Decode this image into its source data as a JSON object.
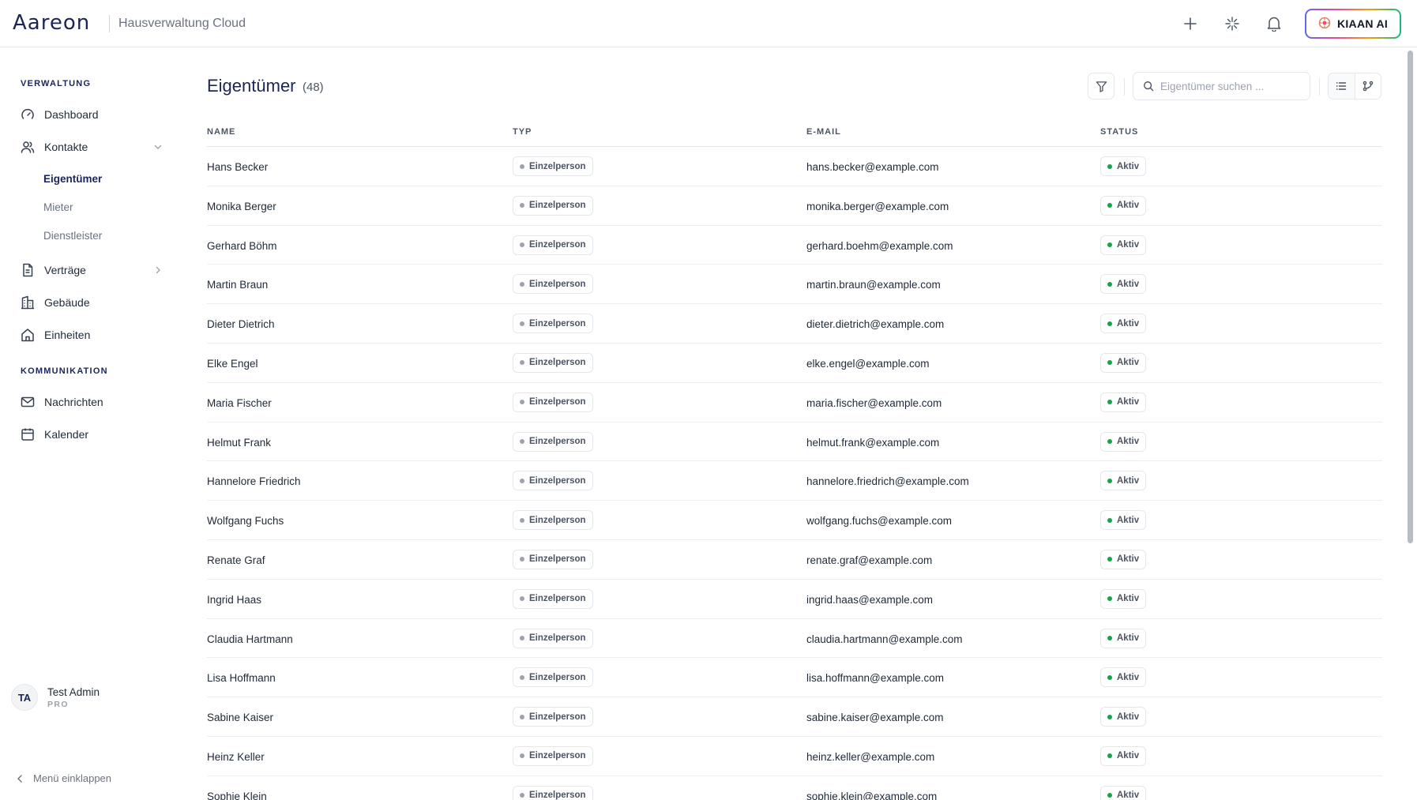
{
  "header": {
    "logo": "Aareon",
    "app_name": "Hausverwaltung Cloud",
    "icons": [
      "plus-icon",
      "sparkle-icon",
      "bell-icon"
    ],
    "ai_button": "KIAAN AI"
  },
  "sidebar": {
    "sections": [
      {
        "title": "VERWALTUNG"
      },
      {
        "title": "KOMMUNIKATION"
      }
    ],
    "items": [
      {
        "label": "Dashboard",
        "icon": "gauge-icon"
      },
      {
        "label": "Kontakte",
        "icon": "users-icon"
      },
      {
        "label": "Verträge",
        "icon": "document-icon"
      },
      {
        "label": "Gebäude",
        "icon": "building-icon"
      },
      {
        "label": "Einheiten",
        "icon": "home-icon"
      },
      {
        "label": "Nachrichten",
        "icon": "mail-icon"
      },
      {
        "label": "Kalender",
        "icon": "calendar-icon"
      }
    ],
    "sub_items": [
      {
        "label": "Eigentümer",
        "active": true
      },
      {
        "label": "Mieter",
        "active": false
      },
      {
        "label": "Dienstleister",
        "active": false
      }
    ],
    "user": {
      "initials": "TA",
      "name": "Test Admin",
      "role": "PRO"
    },
    "collapse_label": "Menü einklappen"
  },
  "main": {
    "title": "Eigentümer",
    "count": "(48)",
    "search_placeholder": "Eigentümer suchen ...",
    "columns": [
      "NAME",
      "TYP",
      "E-MAIL",
      "STATUS"
    ],
    "colors": {
      "status_dot": "#16a34a",
      "type_dot": "#9ca3af",
      "accent": "#1b2559"
    },
    "rows": [
      {
        "name": "Hans Becker",
        "type": "Einzelperson",
        "email": "hans.becker@example.com",
        "status": "Aktiv"
      },
      {
        "name": "Monika Berger",
        "type": "Einzelperson",
        "email": "monika.berger@example.com",
        "status": "Aktiv"
      },
      {
        "name": "Gerhard Böhm",
        "type": "Einzelperson",
        "email": "gerhard.boehm@example.com",
        "status": "Aktiv"
      },
      {
        "name": "Martin Braun",
        "type": "Einzelperson",
        "email": "martin.braun@example.com",
        "status": "Aktiv"
      },
      {
        "name": "Dieter Dietrich",
        "type": "Einzelperson",
        "email": "dieter.dietrich@example.com",
        "status": "Aktiv"
      },
      {
        "name": "Elke Engel",
        "type": "Einzelperson",
        "email": "elke.engel@example.com",
        "status": "Aktiv"
      },
      {
        "name": "Maria Fischer",
        "type": "Einzelperson",
        "email": "maria.fischer@example.com",
        "status": "Aktiv"
      },
      {
        "name": "Helmut Frank",
        "type": "Einzelperson",
        "email": "helmut.frank@example.com",
        "status": "Aktiv"
      },
      {
        "name": "Hannelore Friedrich",
        "type": "Einzelperson",
        "email": "hannelore.friedrich@example.com",
        "status": "Aktiv"
      },
      {
        "name": "Wolfgang Fuchs",
        "type": "Einzelperson",
        "email": "wolfgang.fuchs@example.com",
        "status": "Aktiv"
      },
      {
        "name": "Renate Graf",
        "type": "Einzelperson",
        "email": "renate.graf@example.com",
        "status": "Aktiv"
      },
      {
        "name": "Ingrid Haas",
        "type": "Einzelperson",
        "email": "ingrid.haas@example.com",
        "status": "Aktiv"
      },
      {
        "name": "Claudia Hartmann",
        "type": "Einzelperson",
        "email": "claudia.hartmann@example.com",
        "status": "Aktiv"
      },
      {
        "name": "Lisa Hoffmann",
        "type": "Einzelperson",
        "email": "lisa.hoffmann@example.com",
        "status": "Aktiv"
      },
      {
        "name": "Sabine Kaiser",
        "type": "Einzelperson",
        "email": "sabine.kaiser@example.com",
        "status": "Aktiv"
      },
      {
        "name": "Heinz Keller",
        "type": "Einzelperson",
        "email": "heinz.keller@example.com",
        "status": "Aktiv"
      },
      {
        "name": "Sophie Klein",
        "type": "Einzelperson",
        "email": "sophie.klein@example.com",
        "status": "Aktiv"
      }
    ]
  }
}
